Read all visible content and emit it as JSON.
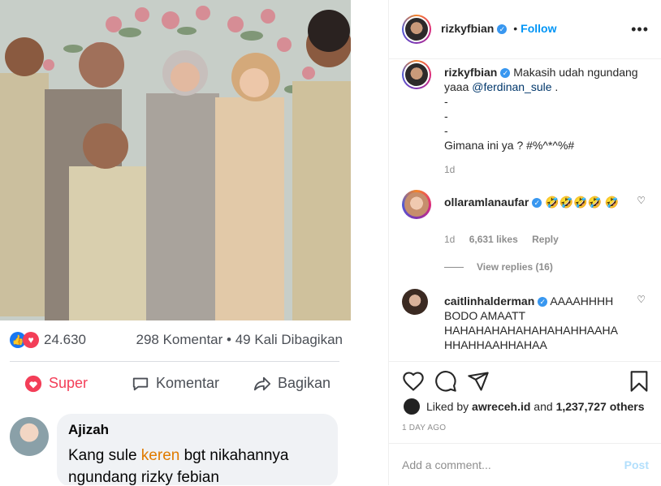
{
  "photo": {
    "facebook": {
      "reactions_count": "24.630",
      "meta": "298 Komentar • 49 Kali Dibagikan",
      "actions": [
        "Super",
        "Komentar",
        "Bagikan"
      ],
      "comment": {
        "author": "Ajizah",
        "text_before": "Kang sule ",
        "text_highlight": "keren",
        "text_after": " bgt nikahannya ngundang rizky febian"
      }
    }
  },
  "header": {
    "username": "rizkyfbian",
    "separator": "•",
    "follow_label": "Follow",
    "more_label": "•••"
  },
  "caption": {
    "username": "rizkyfbian",
    "text_line1": "Makasih udah ngundang yaaa ",
    "mention": "@ferdinan_sule",
    "text_tail": " .",
    "dash1": "-",
    "dash2": "-",
    "dash3": "-",
    "line_last": "Gimana ini ya ? #%^*^%#",
    "time": "1d"
  },
  "comments": [
    {
      "username": "ollaramlanaufar",
      "text": "🤣🤣🤣🤣 🤣",
      "time": "1d",
      "likes": "6,631 likes",
      "reply": "Reply",
      "view_replies": "View replies (16)"
    },
    {
      "username": "caitlinhalderman",
      "text": "AAAAHHHH BODO AMAATT HAHAHAHAHAHAHAHAHHAAHA HHAHHAAHHAHAA"
    }
  ],
  "likes": {
    "prefix": "Liked by ",
    "user": "awreceh.id",
    "middle": " and ",
    "count": "1,237,727 others"
  },
  "timestamp": "1 DAY AGO",
  "add_comment": {
    "placeholder": "Add a comment...",
    "post_label": "Post"
  },
  "colors": {
    "accent": "#0095f6",
    "verified": "#3897f0",
    "post_disabled": "#b2dffc"
  }
}
